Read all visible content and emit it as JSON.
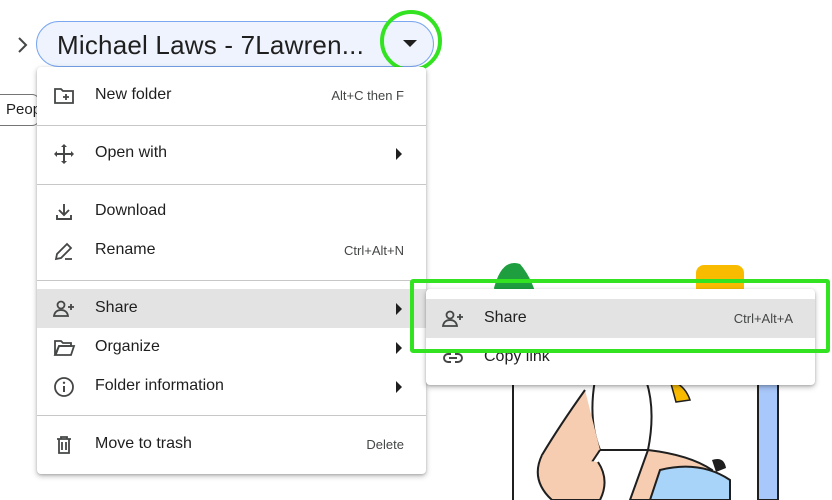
{
  "breadcrumb": {
    "folder_title": "Michael Laws - 7Lawren..."
  },
  "chip": {
    "people_label": "People"
  },
  "menu": {
    "new_folder": {
      "label": "New folder",
      "shortcut": "Alt+C then F",
      "icon": "new-folder-icon"
    },
    "open_with": {
      "label": "Open with",
      "icon": "open-with-icon"
    },
    "download": {
      "label": "Download",
      "icon": "download-icon"
    },
    "rename": {
      "label": "Rename",
      "shortcut": "Ctrl+Alt+N",
      "icon": "rename-icon"
    },
    "share": {
      "label": "Share",
      "icon": "add-person-icon"
    },
    "organize": {
      "label": "Organize",
      "icon": "folder-open-icon"
    },
    "folder_information": {
      "label": "Folder information",
      "icon": "info-icon"
    },
    "move_to_trash": {
      "label": "Move to trash",
      "shortcut": "Delete",
      "icon": "trash-icon"
    }
  },
  "submenu": {
    "share": {
      "label": "Share",
      "shortcut": "Ctrl+Alt+A",
      "icon": "add-person-icon"
    },
    "copy_link": {
      "label": "Copy link",
      "icon": "link-icon"
    }
  },
  "colors": {
    "highlight_green": "#33e322",
    "hover_gray": "#e3e3e3",
    "pill_border": "#7aa7f0",
    "pill_bg": "#eef3fd"
  }
}
